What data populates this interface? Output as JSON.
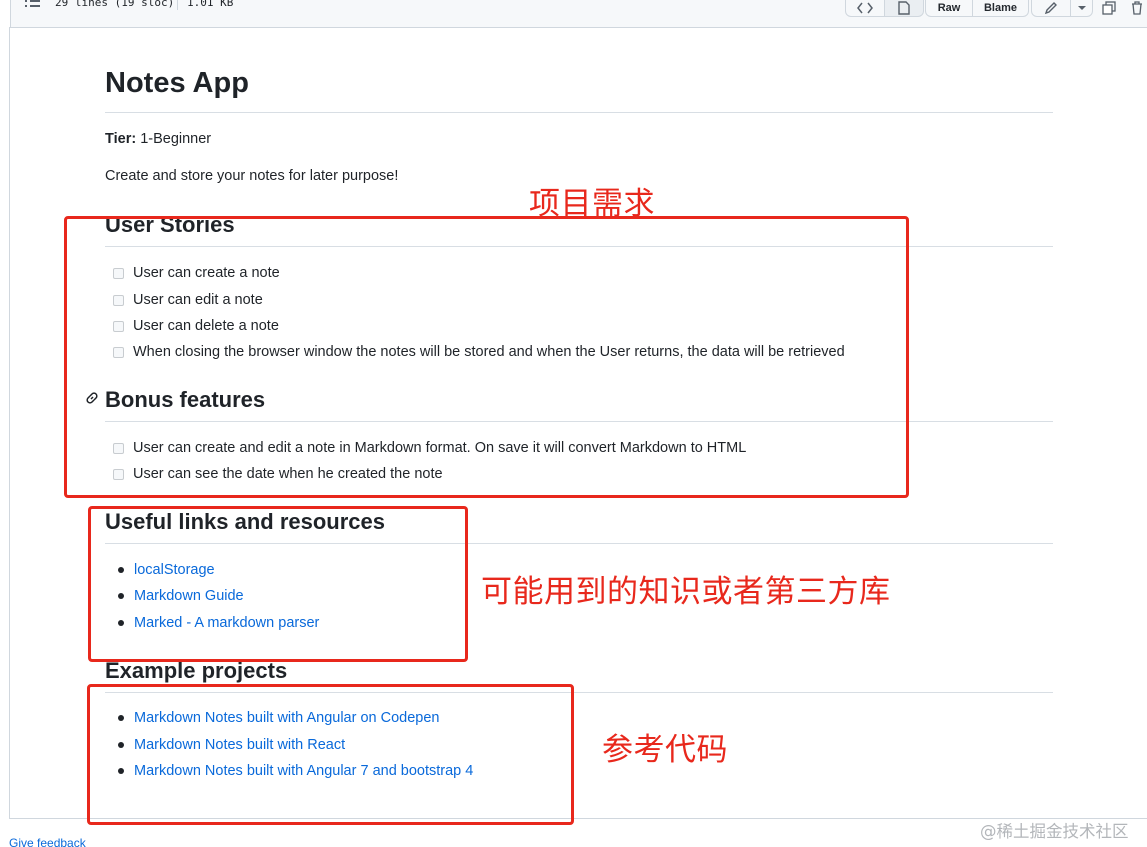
{
  "toolbar": {
    "lines_label": "29 lines (19 sloc)",
    "size_label": "1.01 KB",
    "code_icon": "code-icon",
    "file_icon": "file-icon",
    "raw_label": "Raw",
    "blame_label": "Blame",
    "edit_icon": "pencil-icon",
    "copy_icon": "copy-icon",
    "delete_icon": "trash-icon"
  },
  "readme": {
    "title": "Notes App",
    "tier_label": "Tier:",
    "tier_value": "1-Beginner",
    "description": "Create and store your notes for later purpose!",
    "user_stories": {
      "heading": "User Stories",
      "items": [
        "User can create a note",
        "User can edit a note",
        "User can delete a note",
        "When closing the browser window the notes will be stored and when the User returns, the data will be retrieved"
      ]
    },
    "bonus": {
      "heading": "Bonus features",
      "items": [
        "User can create and edit a note in Markdown format. On save it will convert Markdown to HTML",
        "User can see the date when he created the note"
      ]
    },
    "resources": {
      "heading": "Useful links and resources",
      "items": [
        "localStorage",
        "Markdown Guide",
        "Marked - A markdown parser"
      ]
    },
    "examples": {
      "heading": "Example projects",
      "items": [
        "Markdown Notes built with Angular on Codepen",
        "Markdown Notes built with React",
        "Markdown Notes built with Angular 7 and bootstrap 4"
      ]
    }
  },
  "annotations": {
    "requirements": "项目需求",
    "knowledge": "可能用到的知识或者第三方库",
    "reference": "参考代码",
    "color": "#e8281c"
  },
  "footer": {
    "feedback": "Give feedback",
    "watermark": "@稀土掘金技术社区"
  },
  "colors": {
    "link": "#0969da",
    "text": "#1f2328",
    "border": "#d0d7de"
  }
}
